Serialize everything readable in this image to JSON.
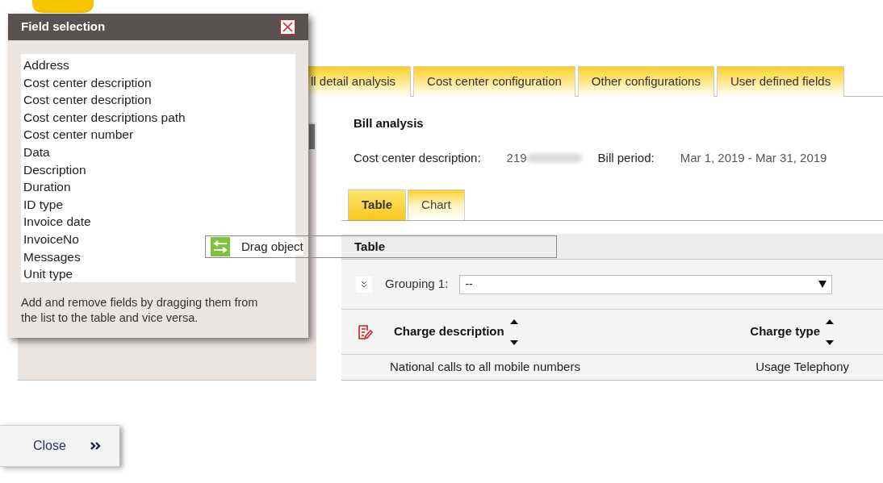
{
  "top_tabs": [
    {
      "label": "ll detail analysis",
      "selected": false
    },
    {
      "label": "Cost center configuration",
      "selected": false
    },
    {
      "label": "Other configurations",
      "selected": false
    },
    {
      "label": "User defined fields",
      "selected": false
    }
  ],
  "bill_analysis": {
    "title": "Bill analysis",
    "cost_center_label": "Cost center description:",
    "cost_center_value": "219",
    "bill_period_label": "Bill period:",
    "bill_period_value": "Mar 1, 2019 - Mar 31, 2019"
  },
  "view_tabs": [
    {
      "label": "Table",
      "selected": true
    },
    {
      "label": "Chart",
      "selected": false
    }
  ],
  "table": {
    "title": "Table",
    "grouping": {
      "label": "Grouping 1:",
      "value": "--",
      "expanded": false
    },
    "columns": [
      "Charge description",
      "Charge type"
    ],
    "rows": [
      [
        "National calls to all mobile numbers",
        "Usage Telephony"
      ]
    ]
  },
  "close_bar": {
    "label": "Close"
  },
  "dialog": {
    "title": "Field selection",
    "fields": [
      "Address",
      "Cost center description",
      "Cost center description",
      "Cost center descriptions path",
      "Cost center number",
      "Data",
      "Description",
      "Duration",
      "ID type",
      "Invoice date",
      "InvoiceNo",
      "Messages",
      "Unit type"
    ],
    "help": "Add and remove fields by dragging them from the list to the table and vice versa."
  },
  "drag_object": {
    "label": "Drag object"
  }
}
